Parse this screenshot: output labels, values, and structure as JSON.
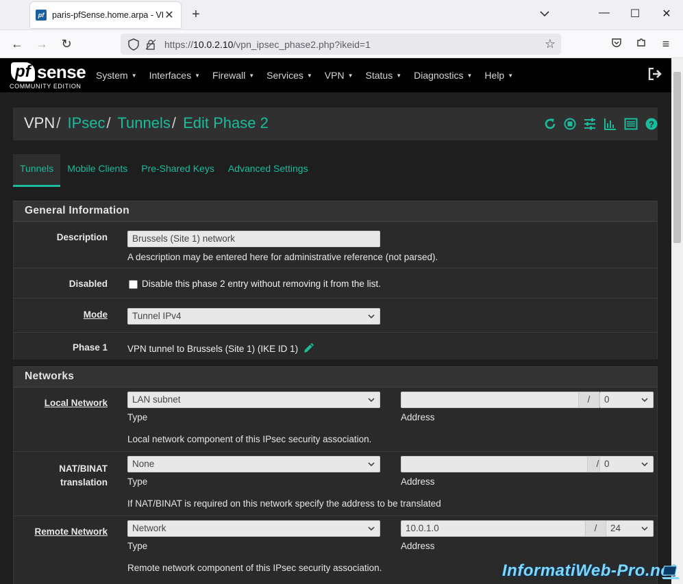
{
  "browser": {
    "tab_title": "paris-pfSense.home.arpa - VPN",
    "tab_favicon": "pf",
    "url_prefix": "https://",
    "url_host": "10.0.2.10",
    "url_path": "/vpn_ipsec_phase2.php?ikeid=1"
  },
  "nav": {
    "logo_pf": "pf",
    "logo_sense": "sense",
    "logo_edition": "COMMUNITY EDITION",
    "menu": [
      "System",
      "Interfaces",
      "Firewall",
      "Services",
      "VPN",
      "Status",
      "Diagnostics",
      "Help"
    ]
  },
  "breadcrumb": {
    "root": "VPN",
    "items": [
      "IPsec",
      "Tunnels",
      "Edit Phase 2"
    ]
  },
  "tabs": [
    "Tunnels",
    "Mobile Clients",
    "Pre-Shared Keys",
    "Advanced Settings"
  ],
  "general": {
    "title": "General Information",
    "description_label": "Description",
    "description_value": "Brussels (Site 1) network",
    "description_help": "A description may be entered here for administrative reference (not parsed).",
    "disabled_label": "Disabled",
    "disabled_text": "Disable this phase 2 entry without removing it from the list.",
    "mode_label": "Mode",
    "mode_value": "Tunnel IPv4",
    "phase1_label": "Phase 1",
    "phase1_value": "VPN tunnel to Brussels (Site 1) (IKE ID 1)"
  },
  "networks": {
    "title": "Networks",
    "local": {
      "label": "Local Network",
      "type": "LAN subnet",
      "address": "",
      "mask": "0",
      "type_caption": "Type",
      "address_caption": "Address",
      "help": "Local network component of this IPsec security association."
    },
    "nat": {
      "label_line1": "NAT/BINAT",
      "label_line2": "translation",
      "type": "None",
      "address": "",
      "mask": "0",
      "type_caption": "Type",
      "address_caption": "Address",
      "help": "If NAT/BINAT is required on this network specify the address to be translated"
    },
    "remote": {
      "label": "Remote Network",
      "type": "Network",
      "address": "10.0.1.0",
      "mask": "24",
      "type_caption": "Type",
      "address_caption": "Address",
      "help": "Remote network component of this IPsec security association."
    },
    "slash": "/"
  },
  "watermark": "InformatiWeb-Pro.net",
  "colors": {
    "accent": "#1abc9c",
    "nav_bg": "#000000",
    "page_bg": "#1e1e1e",
    "panel_bg": "#2c2c2c"
  }
}
